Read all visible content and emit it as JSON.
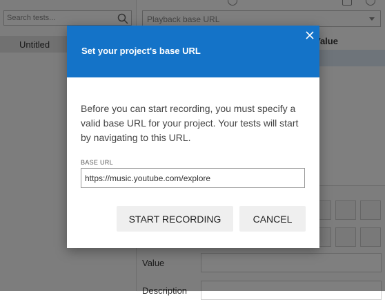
{
  "sidebar": {
    "search_placeholder": "Search tests...",
    "tests": [
      "Untitled"
    ]
  },
  "main": {
    "url_select_placeholder": "Playback base URL",
    "table_header_value": "Value",
    "fields": [
      {
        "label": "Value"
      },
      {
        "label": "Description"
      }
    ]
  },
  "dialog": {
    "title": "Set your project's base URL",
    "body": "Before you can start recording, you must specify a valid base URL for your project. Your tests will start by navigating to this URL.",
    "url_label": "BASE URL",
    "url_value": "https://music.youtube.com/explore",
    "start_button": "START RECORDING",
    "cancel_button": "CANCEL"
  },
  "colors": {
    "header_blue": "#1473c8",
    "overlay": "rgba(0,0,0,0.5)"
  }
}
